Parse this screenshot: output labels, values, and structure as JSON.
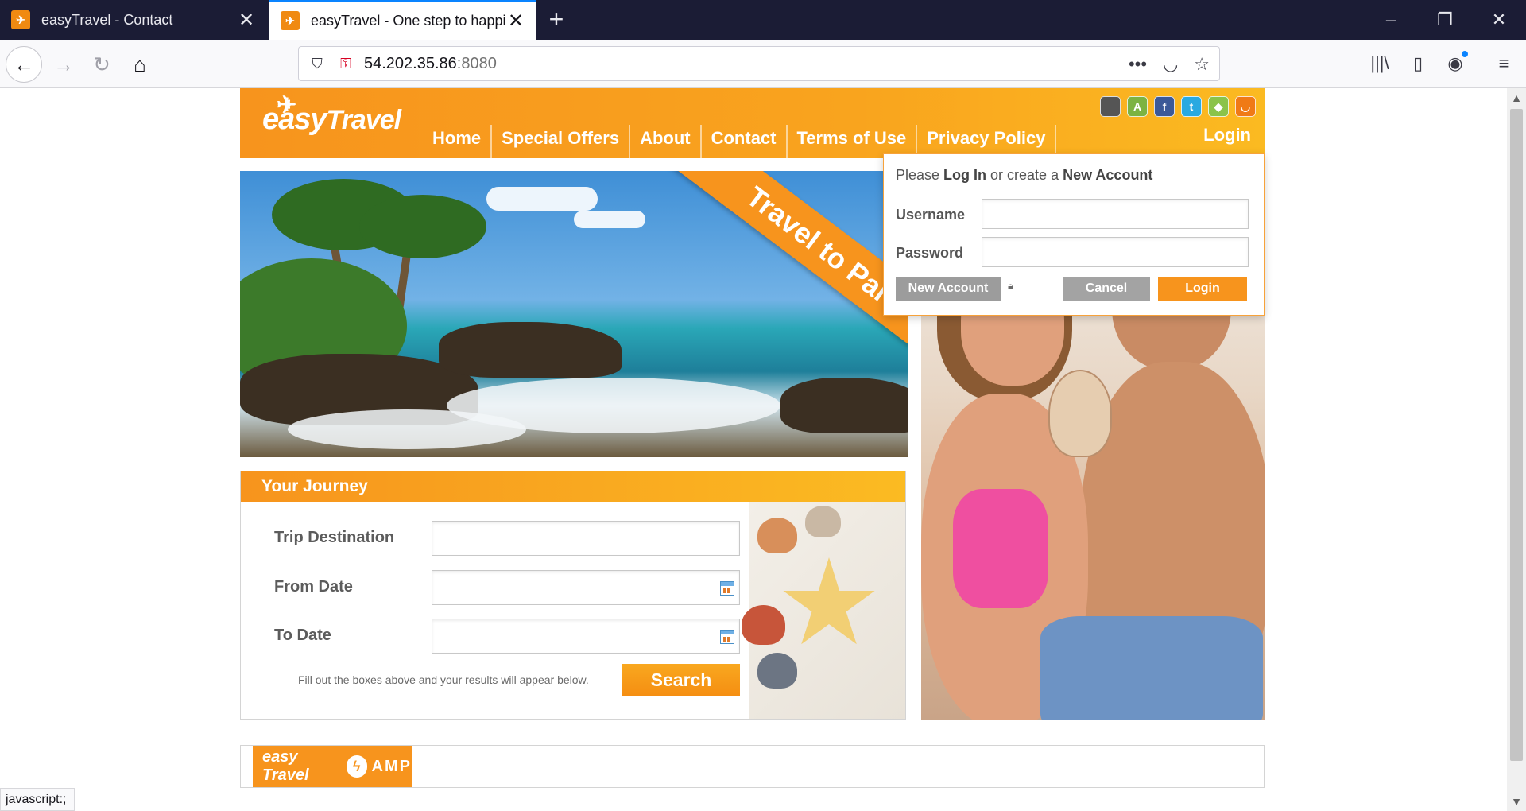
{
  "browser": {
    "tabs": [
      {
        "title": "easyTravel - Contact",
        "active": false
      },
      {
        "title": "easyTravel - One step to happiness",
        "active": true
      }
    ],
    "url_host": "54.202.35.86",
    "url_port": ":8080",
    "status_text": "javascript:;",
    "icons": {
      "new_tab": "+",
      "minimize": "–",
      "restore": "❐",
      "close": "✕",
      "back": "←",
      "forward": "→",
      "reload": "↻",
      "home": "⌂",
      "page_actions": "•••",
      "pocket": "◡",
      "bookmark": "☆",
      "library": "|||\\",
      "sidebar": "▯",
      "account": "◉",
      "menu": "≡"
    }
  },
  "site": {
    "logo_text": "easy",
    "logo_text2": "Travel",
    "nav": [
      "Home",
      "Special Offers",
      "About",
      "Contact",
      "Terms of Use",
      "Privacy Policy"
    ],
    "login_link": "Login",
    "social": [
      "",
      "A",
      "f",
      "t",
      "◆",
      "◡"
    ],
    "hero_ribbon": "Travel to Paris"
  },
  "login_popup": {
    "prompt_please": "Please ",
    "prompt_login": "Log In",
    "prompt_mid": " or create a ",
    "prompt_new": "New Account",
    "username_label": "Username",
    "password_label": "Password",
    "username_value": "",
    "password_value": "",
    "new_account_button": "New Account",
    "cancel_button": "Cancel",
    "login_button": "Login"
  },
  "journey": {
    "title": "Your Journey",
    "fields": [
      {
        "label": "Trip Destination",
        "value": ""
      },
      {
        "label": "From Date",
        "value": ""
      },
      {
        "label": "To Date",
        "value": ""
      }
    ],
    "hint": "Fill out the boxes above and your results will appear below.",
    "search_button": "Search"
  },
  "amp": {
    "logo_easy": "easy Travel",
    "logo_amp": "AMP"
  },
  "colors": {
    "brand_orange": "#f7941d",
    "brand_yellow": "#fbba21",
    "chrome_dark": "#1b1c35"
  }
}
